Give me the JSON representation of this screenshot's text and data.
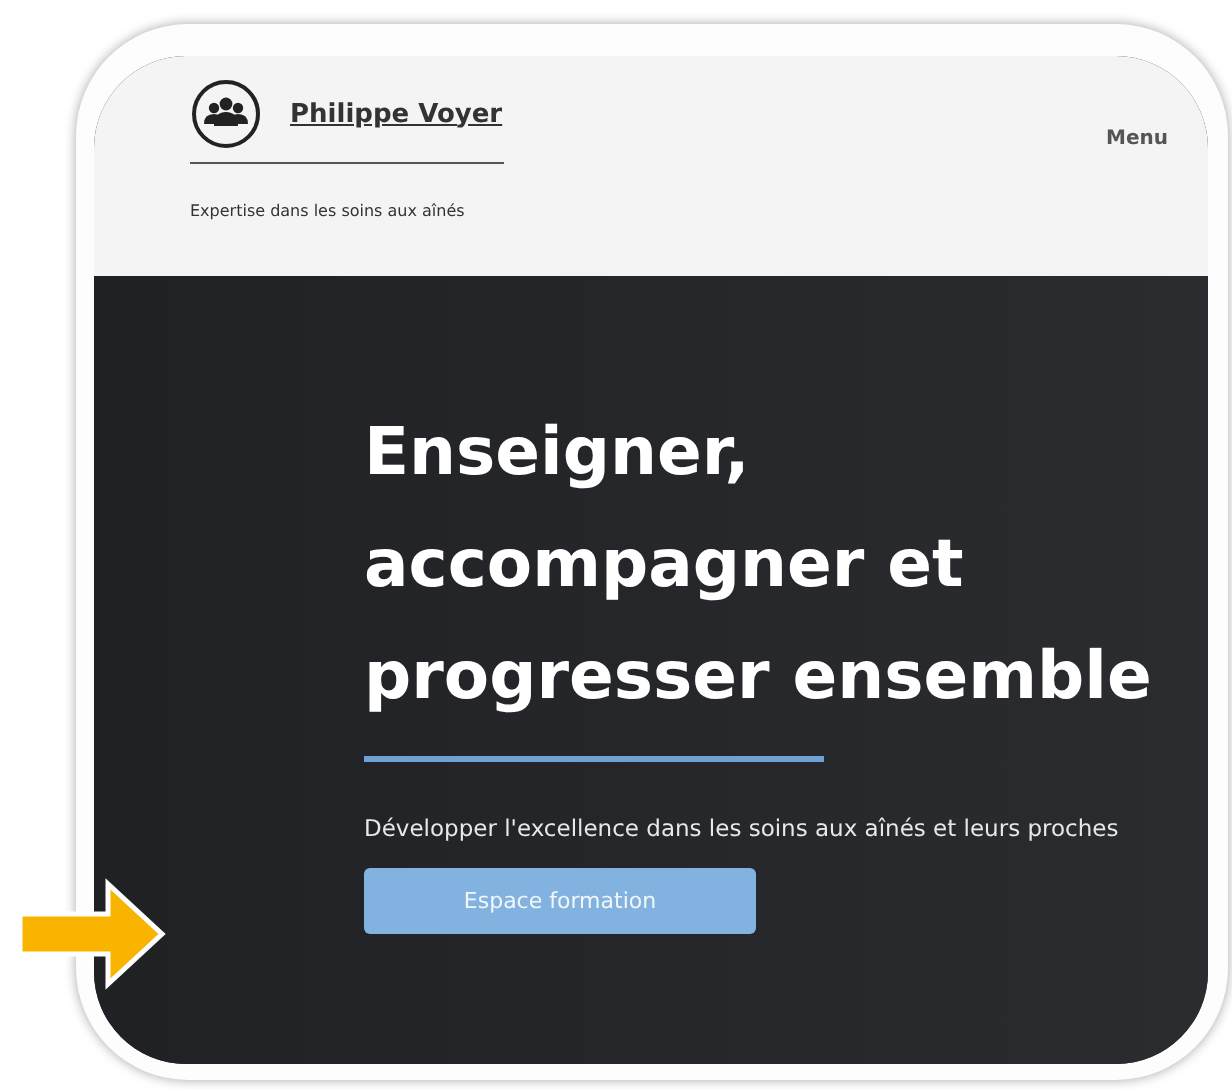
{
  "header": {
    "site_name": "Philippe Voyer",
    "tagline": "Expertise dans les soins aux aînés",
    "menu": "Menu"
  },
  "hero": {
    "title_lines": [
      "Enseigner,",
      "accompagner et",
      "progresser ensemble"
    ],
    "subtitle": "Développer l'excellence dans les soins aux aînés et leurs proches",
    "button": "Espace formation"
  }
}
